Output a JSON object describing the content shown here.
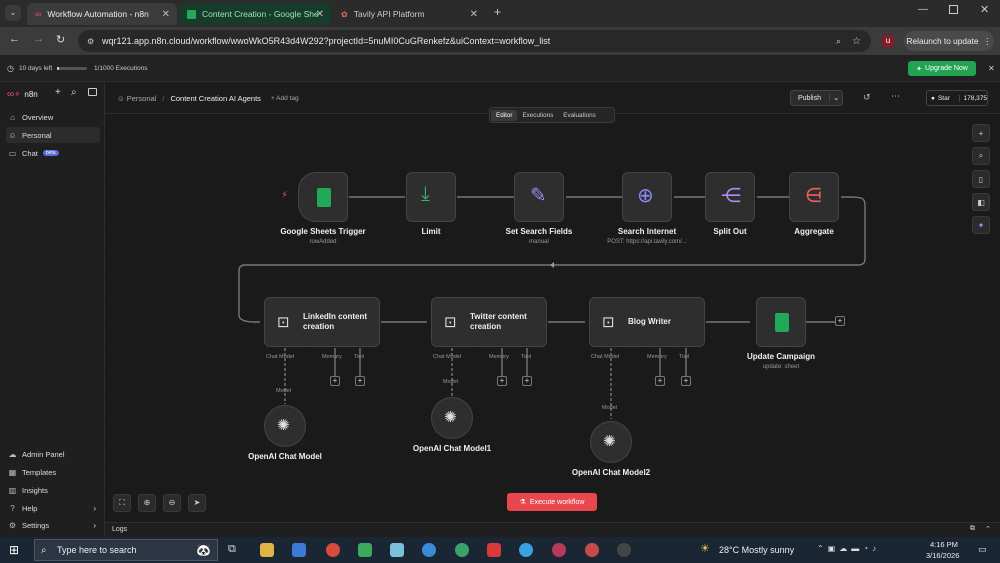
{
  "browser": {
    "tabs": [
      {
        "title": "Workflow Automation - n8n",
        "active": true
      },
      {
        "title": "Content Creation - Google She",
        "active": false
      },
      {
        "title": "Tavily API Platform",
        "active": false
      }
    ],
    "url": "wqr121.app.n8n.cloud/workflow/wwoWkO5R43d4W292?projectId=5nuMI0CuGRenkefz&uiContext=workflow_list",
    "relaunch_label": "Relaunch to update",
    "profile_initial": "u"
  },
  "trial": {
    "days_left": "10 days left",
    "executions": "1/1000 Executions",
    "upgrade_label": "Upgrade Now"
  },
  "sidebar": {
    "brand": "n8n",
    "items": [
      {
        "label": "Overview",
        "icon": "home-icon"
      },
      {
        "label": "Personal",
        "icon": "user-icon"
      },
      {
        "label": "Chat",
        "icon": "chat-icon",
        "badge": "beta"
      }
    ],
    "bottom_items": [
      {
        "label": "Admin Panel",
        "icon": "cloud-icon"
      },
      {
        "label": "Templates",
        "icon": "template-icon"
      },
      {
        "label": "Insights",
        "icon": "insights-icon"
      },
      {
        "label": "Help",
        "icon": "help-icon"
      },
      {
        "label": "Settings",
        "icon": "settings-icon"
      }
    ]
  },
  "header": {
    "breadcrumb_project": "Personal",
    "workflow_name": "Content Creation AI Agents",
    "add_tag": "+ Add tag",
    "publish_label": "Publish",
    "star_label": "Star",
    "star_count": "178,375",
    "tabs": [
      "Editor",
      "Executions",
      "Evaluations"
    ]
  },
  "nodes": {
    "sheets_trigger": {
      "title": "Google Sheets Trigger",
      "subtitle": "rowAdded"
    },
    "limit": {
      "title": "Limit"
    },
    "set_search": {
      "title": "Set Search Fields",
      "subtitle": "manual"
    },
    "search_internet": {
      "title": "Search Internet",
      "subtitle": "POST: https://api.tavily.com/..."
    },
    "split_out": {
      "title": "Split Out"
    },
    "aggregate": {
      "title": "Aggregate"
    },
    "linkedin": {
      "title": "LinkedIn content creation"
    },
    "twitter": {
      "title": "Twitter content creation"
    },
    "blog": {
      "title": "Blog Writer"
    },
    "update_campaign": {
      "title": "Update Campaign",
      "subtitle": "update: sheet"
    },
    "openai0": {
      "title": "OpenAI Chat Model"
    },
    "openai1": {
      "title": "OpenAI Chat Model1"
    },
    "openai2": {
      "title": "OpenAI Chat Model2"
    },
    "port_chat": "Chat Model",
    "port_memory": "Memory",
    "port_tool": "Tool",
    "port_model": "Model"
  },
  "execute_label": "Execute workflow",
  "logs_label": "Logs",
  "taskbar": {
    "search_placeholder": "Type here to search",
    "weather": "28°C  Mostly sunny",
    "time": "4:16 PM",
    "date": "3/16/2026"
  },
  "colors": {
    "accent": "#ea4b71",
    "execute": "#e8474e",
    "sheets": "#22a958",
    "upgrade": "#22a352"
  }
}
